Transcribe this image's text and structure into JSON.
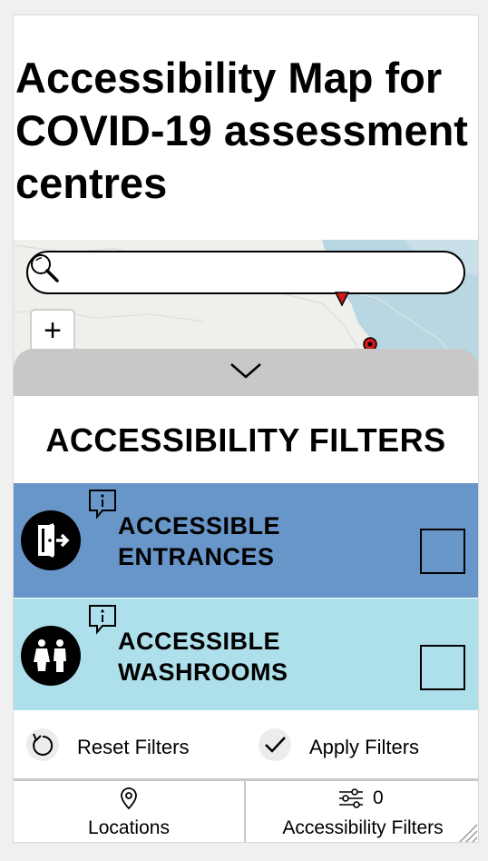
{
  "page": {
    "title": "Accessibility Map for COVID-19 assessment centres"
  },
  "map": {
    "search_placeholder": "",
    "search_value": "",
    "zoom_in_label": "+"
  },
  "sheet": {
    "handle_icon": "chevron-down-icon",
    "title": "ACCESSIBILITY FILTERS"
  },
  "filters": [
    {
      "label_line1": "ACCESSIBLE",
      "label_line2": "ENTRANCES",
      "icon": "door-exit-icon",
      "checked": false,
      "color": "#6896c9"
    },
    {
      "label_line1": "ACCESSIBLE",
      "label_line2": "WASHROOMS",
      "icon": "washroom-icon",
      "checked": false,
      "color": "#aee0ec"
    }
  ],
  "actions": {
    "reset_label": "Reset Filters",
    "apply_label": "Apply Filters"
  },
  "tabs": {
    "locations_label": "Locations",
    "filters_label": "Accessibility Filters",
    "filters_count": "0"
  }
}
